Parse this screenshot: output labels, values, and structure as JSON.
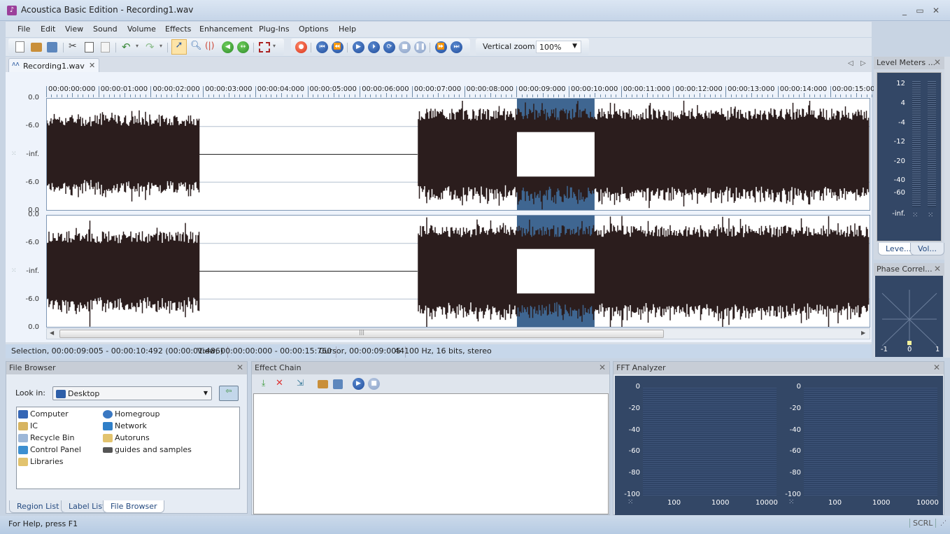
{
  "window": {
    "title": "Acoustica Basic Edition - Recording1.wav",
    "controls": [
      "minimize",
      "maximize",
      "close"
    ]
  },
  "menu": [
    "File",
    "Edit",
    "View",
    "Sound",
    "Volume",
    "Effects",
    "Enhancement",
    "Plug-Ins",
    "Options",
    "Help"
  ],
  "toolbar": {
    "vertical_zoom_label": "Vertical zoom:",
    "vertical_zoom_value": "100%",
    "icons": [
      "new-file-icon",
      "open-icon",
      "save-icon",
      "cut-icon",
      "copy-icon",
      "paste-icon",
      "undo-icon",
      "redo-icon",
      "select-tool-icon",
      "zoom-tool-icon",
      "scrub-tool-icon",
      "go-back-icon",
      "fit-icon",
      "grid-icon",
      "record-icon",
      "go-to-start-icon",
      "rewind-icon",
      "play-icon",
      "play-selection-icon",
      "loop-icon",
      "stop-icon",
      "pause-icon",
      "fast-forward-icon",
      "go-to-end-icon"
    ]
  },
  "document": {
    "tab_label": "Recording1.wav",
    "ruler": [
      "00:00:00:000",
      "00:00:01:000",
      "00:00:02:000",
      "00:00:03:000",
      "00:00:04:000",
      "00:00:05:000",
      "00:00:06:000",
      "00:00:07:000",
      "00:00:08:000",
      "00:00:09:000",
      "00:00:10:000",
      "00:00:11:000",
      "00:00:12:000",
      "00:00:13:000",
      "00:00:14:000",
      "00:00:15:00"
    ],
    "channel_scale": [
      "0.0",
      "-6.0",
      "-inf.",
      "-6.0",
      "0.0"
    ],
    "selection_start_s": 9.005,
    "selection_end_s": 10.492,
    "view_end_s": 15.76
  },
  "status": {
    "selection": "Selection, 00:00:09:005 - 00:00:10:492 (00:00:01:486)",
    "view": "View, 00:00:00:000 - 00:00:15:760",
    "cursor": "Cursor, 00:00:09:005",
    "format": "44100 Hz, 16 bits, stereo"
  },
  "level_meters": {
    "title": "Level Meters ...",
    "scale": [
      "12",
      "4",
      "-4",
      "-12",
      "-20",
      "-40",
      "-60",
      "-inf."
    ],
    "tabs": [
      "Leve...",
      "Vol..."
    ]
  },
  "phase": {
    "title": "Phase Correl...",
    "scale": [
      "-1",
      "0",
      "1"
    ],
    "value": 0
  },
  "file_browser": {
    "title": "File Browser",
    "look_in_label": "Look in:",
    "look_in_value": "Desktop",
    "items_col1": [
      "Computer",
      "IC",
      "Recycle Bin",
      "Control Panel",
      "Libraries"
    ],
    "items_col2": [
      "Homegroup",
      "Network",
      "Autoruns",
      "guides and samples"
    ],
    "tabs": [
      "Region List",
      "Label List",
      "File Browser"
    ]
  },
  "effect_chain": {
    "title": "Effect Chain"
  },
  "fft": {
    "title": "FFT Analyzer",
    "y": [
      "0",
      "-20",
      "-40",
      "-60",
      "-80",
      "-100"
    ],
    "x": [
      "100",
      "1000",
      "10000"
    ]
  },
  "help": {
    "text": "For Help, press F1",
    "scrl": "SCRL"
  }
}
